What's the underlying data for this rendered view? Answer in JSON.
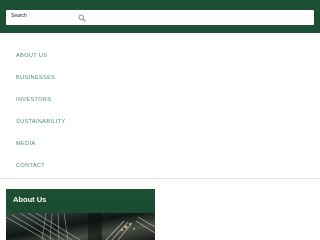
{
  "search": {
    "placeholder": "Search",
    "icon": "search-icon"
  },
  "nav": {
    "items": [
      {
        "label": "ABOUT US"
      },
      {
        "label": "BUSINESSES"
      },
      {
        "label": "INVESTORS"
      },
      {
        "label": "SUSTAINABILITY"
      },
      {
        "label": "MEDIA"
      },
      {
        "label": "CONTACT"
      }
    ]
  },
  "about_card": {
    "title": "About Us"
  },
  "colors": {
    "brand_green": "#1d4e36",
    "nav_link": "#4d8a72",
    "card_title": "#ffffff"
  }
}
